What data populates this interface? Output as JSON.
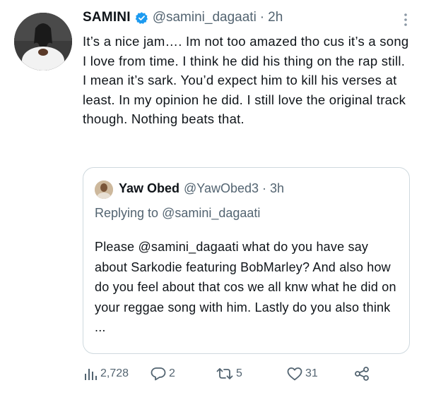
{
  "tweet": {
    "author_name": "SAMINI",
    "author_handle": "@samini_dagaati",
    "separator": "·",
    "time": "2h",
    "text": "It’s a nice jam…. Im not too amazed tho cus it’s a song I love from time. I think he did his thing on the rap still. I mean it’s sark. You’d expect him to kill his verses at least. In my opinion he did. I still love the original track though. Nothing beats that."
  },
  "quoted_tweet": {
    "author_name": "Yaw Obed",
    "author_handle": "@YawObed3",
    "separator": "·",
    "time": "3h",
    "replying_prefix": "Replying to",
    "replying_to": "@samini_dagaati",
    "text": "Please @samini_dagaati what do you have say about Sarkodie featuring BobMarley? And also how do you feel about that cos we all knw what he did on your reggae song with him.  Lastly do you also think ..."
  },
  "actions": {
    "views": "2,728",
    "replies": "2",
    "retweets": "5",
    "likes": "31"
  },
  "icons": {
    "verified": "verified-badge-icon",
    "more": "more-vertical-icon",
    "views": "views-bar-chart-icon",
    "reply": "reply-bubble-icon",
    "retweet": "retweet-icon",
    "like": "heart-icon",
    "share": "share-icon"
  },
  "colors": {
    "text": "#0f1419",
    "secondary": "#536471",
    "verified": "#1d9bf0",
    "border": "#cfd9de"
  }
}
